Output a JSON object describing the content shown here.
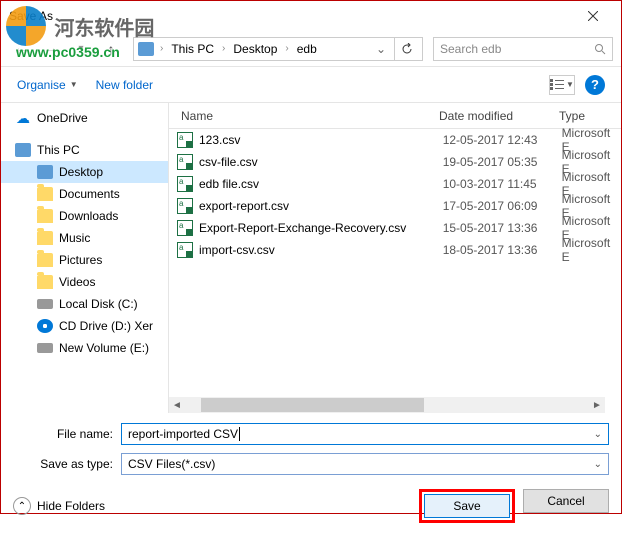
{
  "watermark": {
    "text1": "河东软件园",
    "text2": "www.pc0359.cn"
  },
  "titlebar": {
    "title": "Save As"
  },
  "breadcrumb": {
    "root": "This PC",
    "items": [
      "Desktop",
      "edb"
    ]
  },
  "search": {
    "placeholder": "Search edb"
  },
  "toolbar": {
    "organise": "Organise",
    "new_folder": "New folder"
  },
  "sidebar": {
    "items": [
      {
        "label": "OneDrive",
        "icon": "onedrive",
        "nested": false
      },
      {
        "label": "This PC",
        "icon": "pc",
        "nested": false
      },
      {
        "label": "Desktop",
        "icon": "desktop",
        "nested": true,
        "selected": true
      },
      {
        "label": "Documents",
        "icon": "folder",
        "nested": true
      },
      {
        "label": "Downloads",
        "icon": "folder",
        "nested": true
      },
      {
        "label": "Music",
        "icon": "folder",
        "nested": true
      },
      {
        "label": "Pictures",
        "icon": "folder",
        "nested": true
      },
      {
        "label": "Videos",
        "icon": "folder",
        "nested": true
      },
      {
        "label": "Local Disk (C:)",
        "icon": "disk",
        "nested": true
      },
      {
        "label": "CD Drive (D:) Xer",
        "icon": "cd",
        "nested": true
      },
      {
        "label": "New Volume (E:)",
        "icon": "disk",
        "nested": true
      }
    ]
  },
  "filelist": {
    "headers": {
      "name": "Name",
      "date": "Date modified",
      "type": "Type"
    },
    "rows": [
      {
        "name": "123.csv",
        "date": "12-05-2017 12:43",
        "type": "Microsoft E"
      },
      {
        "name": "csv-file.csv",
        "date": "19-05-2017 05:35",
        "type": "Microsoft E"
      },
      {
        "name": "edb file.csv",
        "date": "10-03-2017 11:45",
        "type": "Microsoft E"
      },
      {
        "name": "export-report.csv",
        "date": "17-05-2017 06:09",
        "type": "Microsoft E"
      },
      {
        "name": "Export-Report-Exchange-Recovery.csv",
        "date": "15-05-2017 13:36",
        "type": "Microsoft E"
      },
      {
        "name": "import-csv.csv",
        "date": "18-05-2017 13:36",
        "type": "Microsoft E"
      }
    ]
  },
  "form": {
    "filename_label": "File name:",
    "filename_value": "report-imported CSV",
    "type_label": "Save as type:",
    "type_value": "CSV Files(*.csv)"
  },
  "footer": {
    "hide_folders": "Hide Folders",
    "save": "Save",
    "cancel": "Cancel"
  }
}
